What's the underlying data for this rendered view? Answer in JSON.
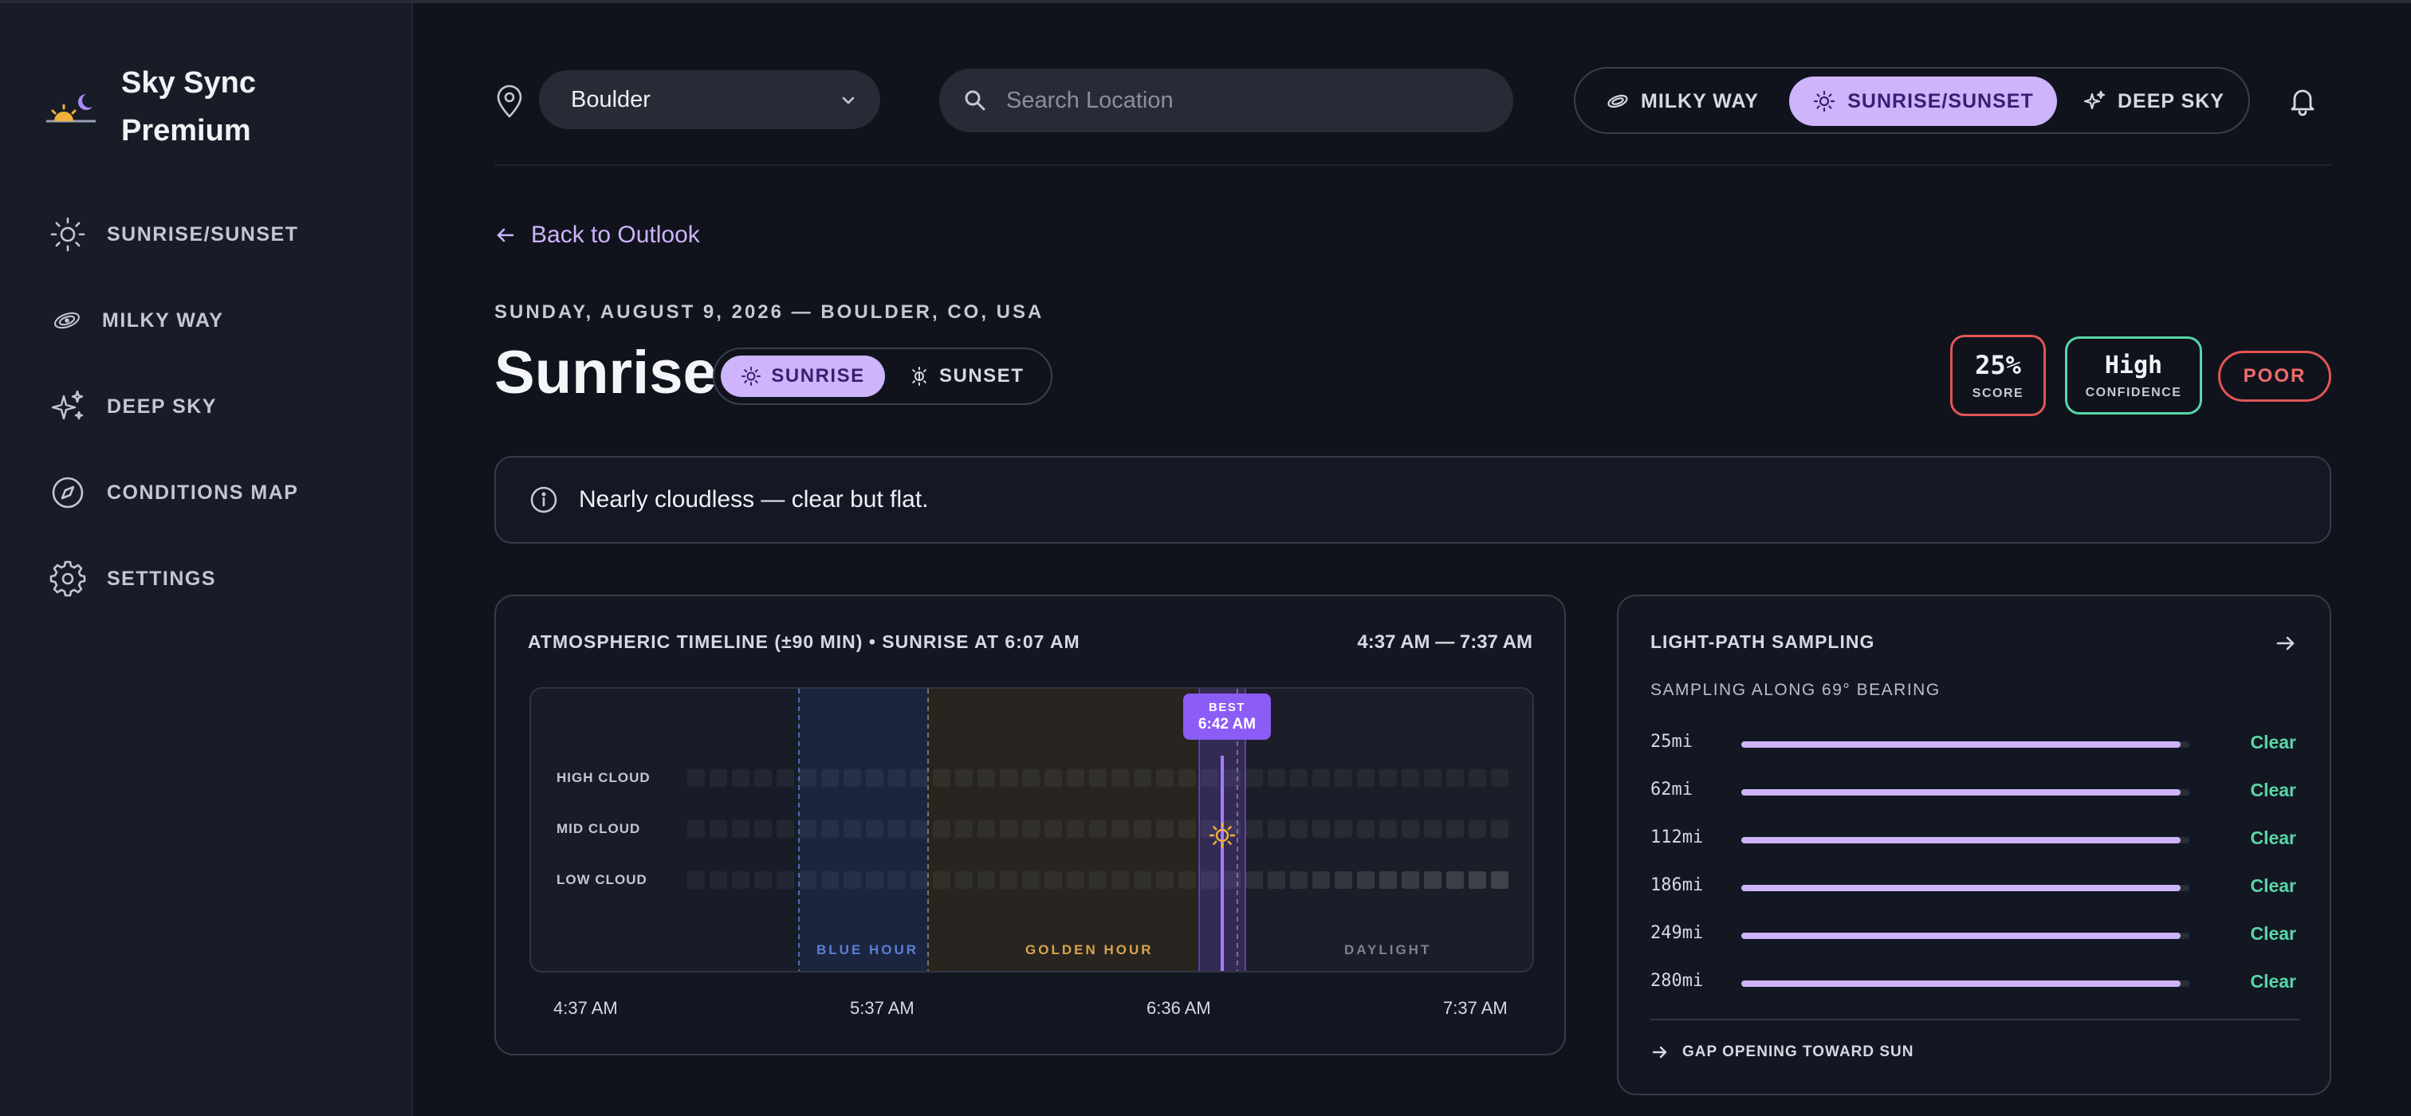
{
  "app": {
    "title_line1": "Sky Sync",
    "title_line2": "Premium"
  },
  "sidebar": {
    "items": [
      {
        "label": "SUNRISE/SUNSET",
        "icon": "sun-icon"
      },
      {
        "label": "MILKY WAY",
        "icon": "galaxy-icon"
      },
      {
        "label": "DEEP SKY",
        "icon": "sparkles-icon"
      },
      {
        "label": "CONDITIONS MAP",
        "icon": "compass-icon"
      },
      {
        "label": "SETTINGS",
        "icon": "gear-icon"
      }
    ]
  },
  "header": {
    "location_value": "Boulder",
    "search_placeholder": "Search Location",
    "modes": [
      {
        "label": "MILKY WAY",
        "active": false
      },
      {
        "label": "SUNRISE/SUNSET",
        "active": true
      },
      {
        "label": "DEEP SKY",
        "active": false
      }
    ]
  },
  "page": {
    "back_label": "Back to Outlook",
    "date_line": "SUNDAY, AUGUST 9, 2026 — BOULDER, CO, USA",
    "title": "Sunrise",
    "toggle": {
      "sunrise": "SUNRISE",
      "sunset": "SUNSET",
      "active": "sunrise"
    },
    "score": {
      "value": "25%",
      "label": "SCORE"
    },
    "confidence": {
      "value": "High",
      "label": "CONFIDENCE"
    },
    "rating": "POOR",
    "info_message": "Nearly cloudless — clear but flat."
  },
  "timeline": {
    "title": "ATMOSPHERIC TIMELINE (±90 MIN) • SUNRISE AT 6:07 AM",
    "range": "4:37 AM — 7:37 AM",
    "rows": [
      "HIGH CLOUD",
      "MID CLOUD",
      "LOW CLOUD"
    ],
    "zones": {
      "blue": "BLUE HOUR",
      "golden": "GOLDEN HOUR",
      "daylight": "DAYLIGHT"
    },
    "best_label": "BEST",
    "best_time": "6:42 AM",
    "ticks": [
      "4:37 AM",
      "5:37 AM",
      "6:36 AM",
      "7:37 AM"
    ],
    "colors": {
      "blue": "#5a7fd6",
      "golden": "#d8a34a",
      "best": "#8b5cf6"
    }
  },
  "light_path": {
    "title": "LIGHT-PATH SAMPLING",
    "subtitle": "SAMPLING ALONG 69° BEARING",
    "samples": [
      {
        "distance": "25mi",
        "status": "Clear",
        "fill": 0.98
      },
      {
        "distance": "62mi",
        "status": "Clear",
        "fill": 0.98
      },
      {
        "distance": "112mi",
        "status": "Clear",
        "fill": 0.98
      },
      {
        "distance": "186mi",
        "status": "Clear",
        "fill": 0.98
      },
      {
        "distance": "249mi",
        "status": "Clear",
        "fill": 0.98
      },
      {
        "distance": "280mi",
        "status": "Clear",
        "fill": 0.98
      }
    ],
    "footer": "GAP OPENING TOWARD SUN"
  }
}
